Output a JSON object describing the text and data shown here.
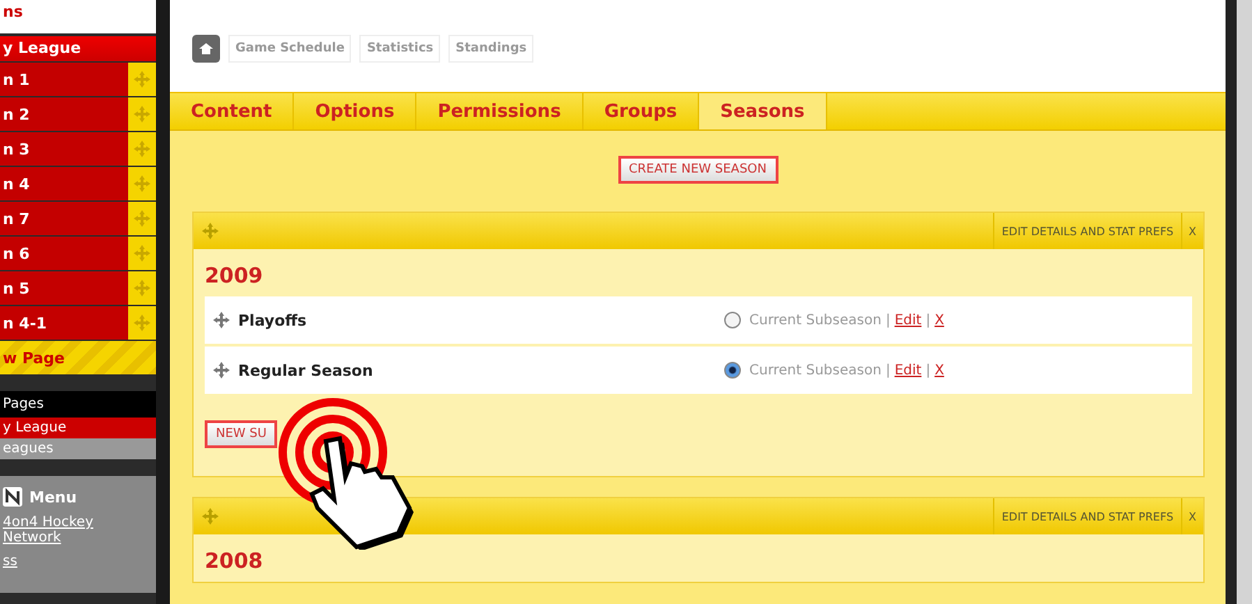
{
  "sidebar": {
    "top_label": "ns",
    "league": "y League",
    "pages": [
      {
        "label": "n 1"
      },
      {
        "label": "n 2"
      },
      {
        "label": "n 3"
      },
      {
        "label": "n 4"
      },
      {
        "label": "n 7"
      },
      {
        "label": "n 6"
      },
      {
        "label": "n 5"
      },
      {
        "label": "n 4-1"
      }
    ],
    "new_page": "w Page",
    "pages_header": "Pages",
    "page_links": [
      {
        "label": "y League",
        "selected": true
      },
      {
        "label": "eagues",
        "selected": false
      }
    ],
    "menu": {
      "title": "Menu",
      "links": [
        "4on4 Hockey Network",
        "ss"
      ]
    }
  },
  "nav": {
    "items": [
      "Game Schedule",
      "Statistics",
      "Standings"
    ]
  },
  "tabs": [
    {
      "label": "Content",
      "selected": false
    },
    {
      "label": "Options",
      "selected": false
    },
    {
      "label": "Permissions",
      "selected": false
    },
    {
      "label": "Groups",
      "selected": false
    },
    {
      "label": "Seasons",
      "selected": true
    }
  ],
  "create_button": "CREATE NEW SEASON",
  "seasons": [
    {
      "title": "2009",
      "header_action": "EDIT DETAILS AND STAT PREFS",
      "close": "X",
      "subseasons": [
        {
          "name": "Playoffs",
          "current_label": "Current Subseason",
          "separator": "|",
          "edit": "Edit",
          "delete": "X",
          "selected": false
        },
        {
          "name": "Regular Season",
          "current_label": "Current Subseason",
          "separator": "|",
          "edit": "Edit",
          "delete": "X",
          "selected": true
        }
      ],
      "new_button": "NEW SU"
    },
    {
      "title": "2008",
      "header_action": "EDIT DETAILS AND STAT PREFS",
      "close": "X"
    }
  ]
}
